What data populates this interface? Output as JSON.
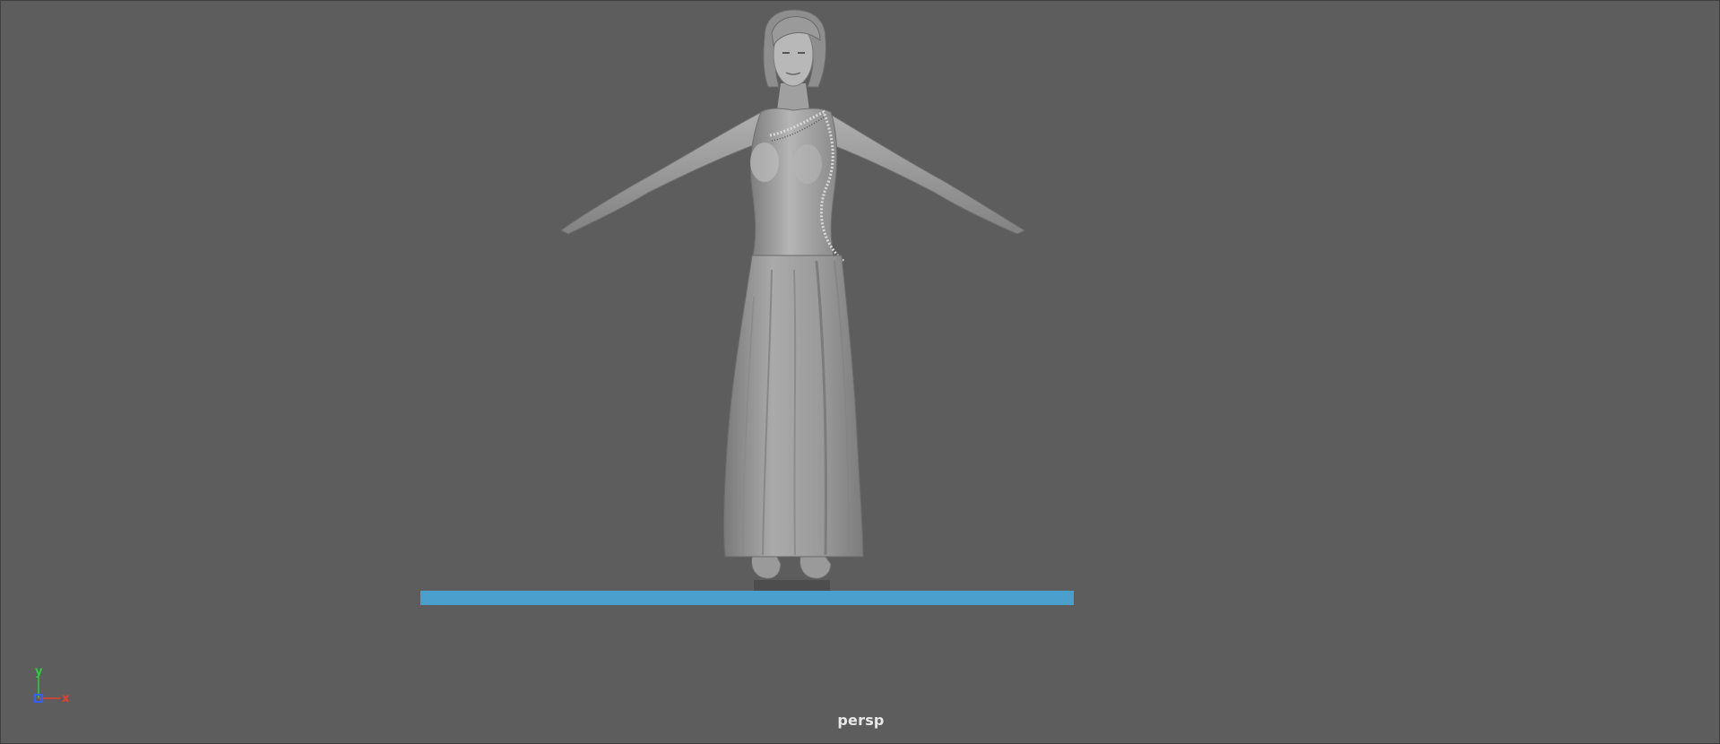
{
  "viewport": {
    "camera_name": "persp",
    "background_color": "#5d5d5d",
    "model": {
      "name": "female-character-model",
      "pose": "T-pose",
      "shading_color": "#a8a8a8"
    },
    "ground_plane": {
      "color": "#4a9fcc"
    },
    "axis_gizmo": {
      "y_label": "y",
      "x_label": "x",
      "y_color": "#2ecc40",
      "x_color": "#e84030",
      "z_color": "#3060ff"
    }
  }
}
